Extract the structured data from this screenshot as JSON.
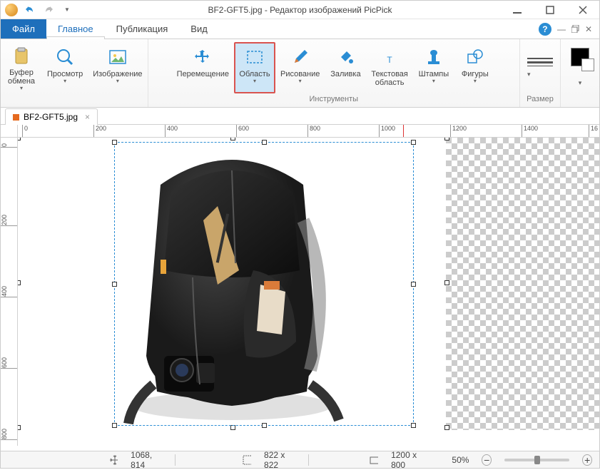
{
  "titlebar": {
    "filename": "BF2-GFT5.jpg",
    "app_suffix": " - Редактор изображений PicPick"
  },
  "menu": {
    "file": "Файл",
    "tabs": [
      "Главное",
      "Публикация",
      "Вид"
    ],
    "active_index": 0
  },
  "ribbon": {
    "clipboard": {
      "label": "Буфер\nобмена"
    },
    "view": {
      "label": "Просмотр"
    },
    "image": {
      "label": "Изображение"
    },
    "move": {
      "label": "Перемещение"
    },
    "area": {
      "label": "Область"
    },
    "draw": {
      "label": "Рисование"
    },
    "fill": {
      "label": "Заливка"
    },
    "text": {
      "label": "Текстовая\nобласть"
    },
    "stamp": {
      "label": "Штампы"
    },
    "shapes": {
      "label": "Фигуры"
    },
    "group_tools": "Инструменты",
    "group_size": "Размер"
  },
  "doc_tab": {
    "name": "BF2-GFT5.jpg"
  },
  "ruler_h": [
    "0",
    "200",
    "400",
    "600",
    "800",
    "1000",
    "1200",
    "1400",
    "16"
  ],
  "ruler_v": [
    "0",
    "200",
    "400",
    "600",
    "800"
  ],
  "status": {
    "cursor_pos": "1068, 814",
    "sel_size": "822 x 822",
    "canvas_size": "1200 x 800",
    "zoom": "50%"
  },
  "colors": {
    "primary": "#000000",
    "secondary": "#ffffff"
  }
}
